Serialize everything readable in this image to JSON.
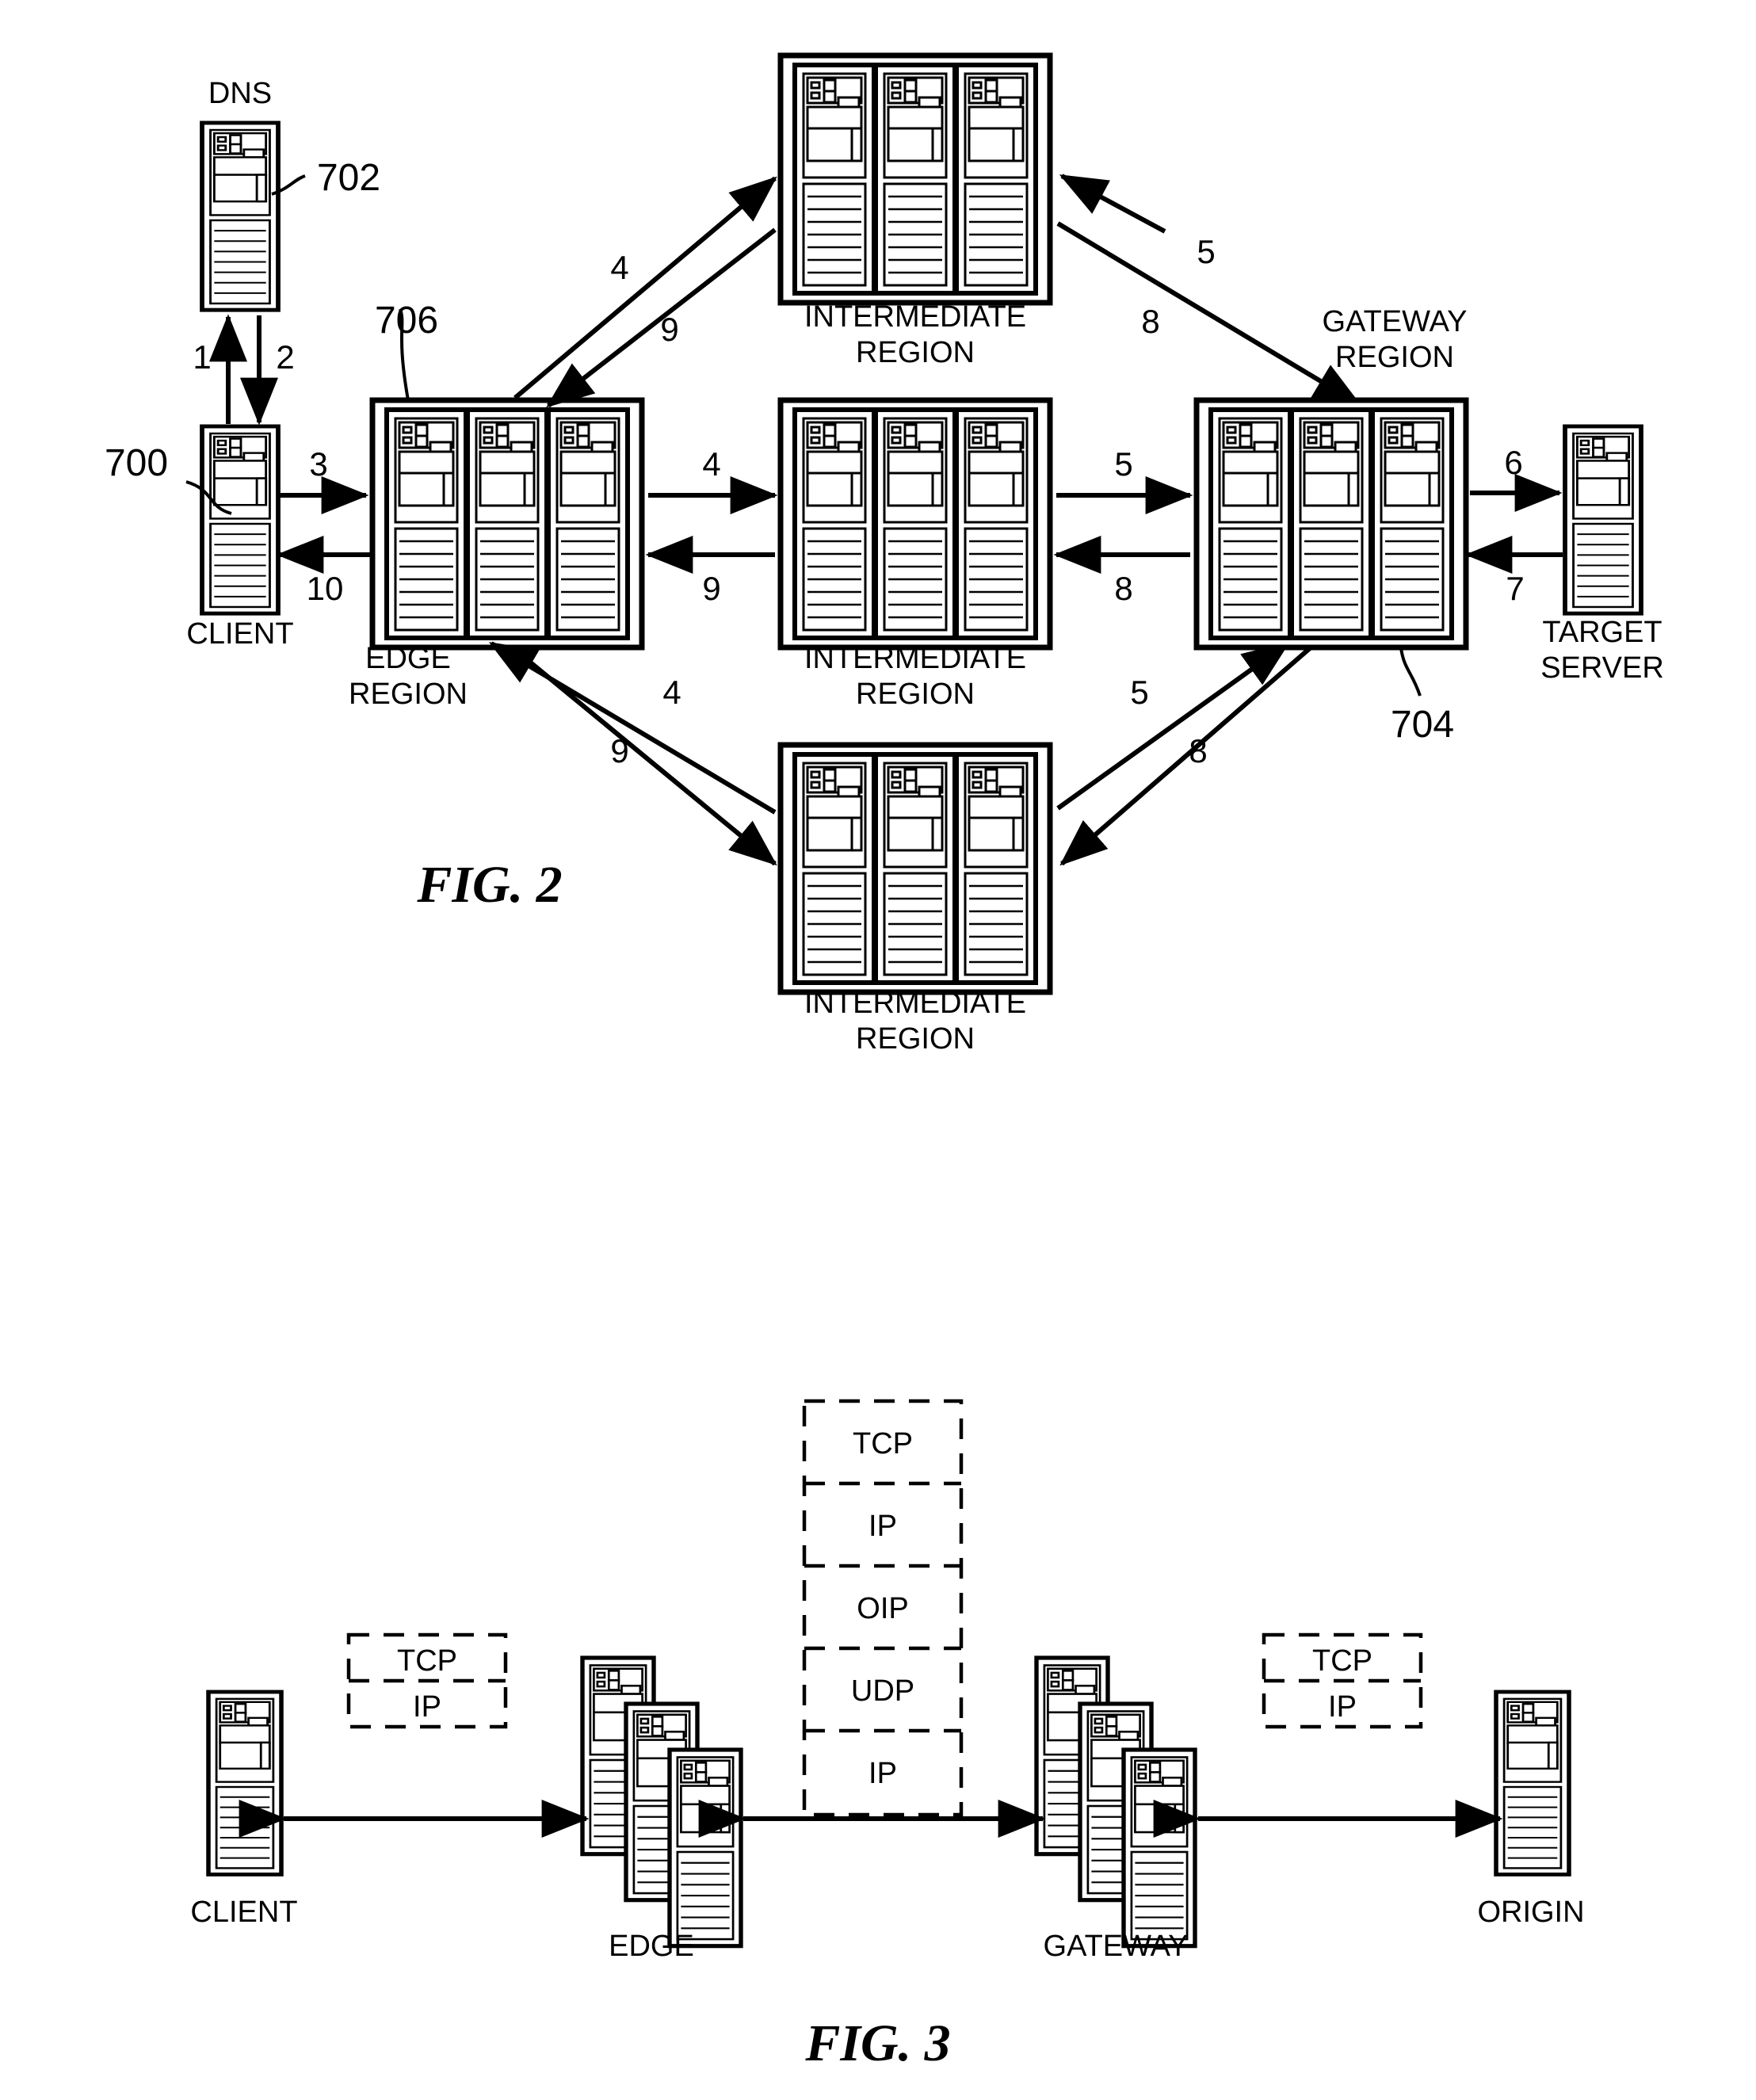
{
  "figures": [
    {
      "caption": "FIG. 2",
      "nodes": {
        "dns": "DNS",
        "client": "CLIENT",
        "edge_region_line1": "EDGE",
        "edge_region_line2": "REGION",
        "intermediate_line1": "INTERMEDIATE",
        "intermediate_line2": "REGION",
        "gateway_line1": "GATEWAY",
        "gateway_line2": "REGION",
        "target_line1": "TARGET",
        "target_line2": "SERVER"
      },
      "reference_numerals": {
        "client": "700",
        "dns": "702",
        "gateway_region": "704",
        "edge_region": "706"
      },
      "step_numbers": {
        "client_to_dns": "1",
        "dns_to_client": "2",
        "client_to_edge": "3",
        "edge_to_client": "10",
        "edge_to_intermediate": "4",
        "intermediate_to_edge": "9",
        "intermediate_to_gateway": "5",
        "gateway_to_intermediate": "8",
        "gateway_to_target": "6",
        "target_to_gateway": "7"
      }
    },
    {
      "caption": "FIG. 3",
      "nodes": {
        "client": "CLIENT",
        "edge": "EDGE",
        "gateway": "GATEWAY",
        "origin": "ORIGIN"
      },
      "protocol_stacks": [
        {
          "id": "client-edge",
          "layers": [
            "TCP",
            "IP"
          ]
        },
        {
          "id": "edge-gateway",
          "layers": [
            "TCP",
            "IP",
            "OIP",
            "UDP",
            "IP"
          ]
        },
        {
          "id": "gateway-origin",
          "layers": [
            "TCP",
            "IP"
          ]
        }
      ]
    }
  ],
  "colors": {
    "ink": "#000000",
    "paper": "#ffffff"
  }
}
